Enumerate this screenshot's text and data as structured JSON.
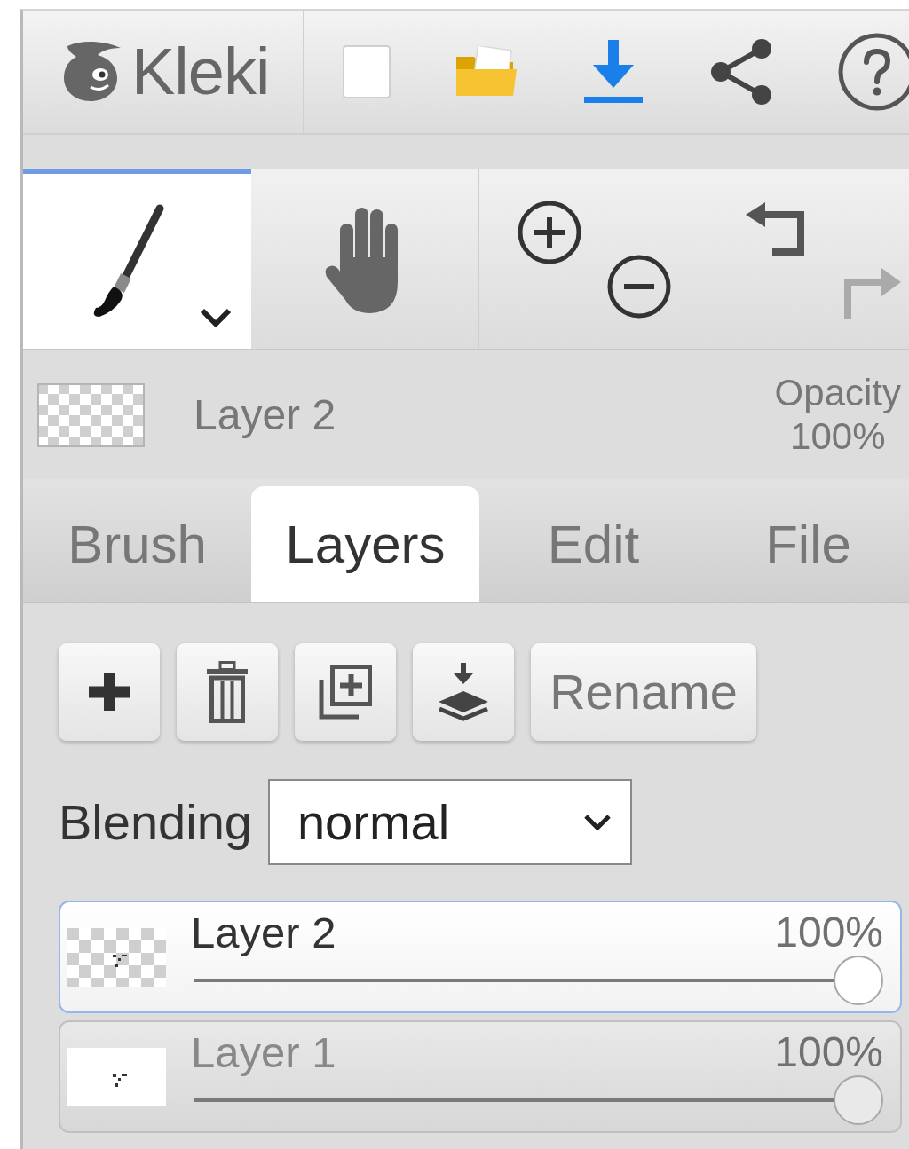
{
  "app": {
    "name": "Kleki"
  },
  "tools": [
    {
      "kind": "brush",
      "selected": true
    },
    {
      "kind": "hand",
      "selected": false
    }
  ],
  "history": {
    "undo": {
      "disabled": false
    },
    "redo": {
      "disabled": true
    }
  },
  "current_layer": {
    "name": "Layer 2",
    "opacity_label": "Opacity",
    "opacity": "100%"
  },
  "tabs": [
    {
      "label": "Brush",
      "selected": false
    },
    {
      "label": "Layers",
      "selected": true
    },
    {
      "label": "Edit",
      "selected": false
    },
    {
      "label": "File",
      "selected": false
    }
  ],
  "layer_actions": {
    "rename": "Rename"
  },
  "blending": {
    "label": "Blending",
    "value": "normal"
  },
  "layers": [
    {
      "name": "Layer 2",
      "opacity": "100%",
      "level": 1,
      "selected": true,
      "kind": "transparent"
    },
    {
      "name": "Layer 1",
      "opacity": "100%",
      "level": 1,
      "selected": false,
      "kind": "opaque"
    }
  ]
}
